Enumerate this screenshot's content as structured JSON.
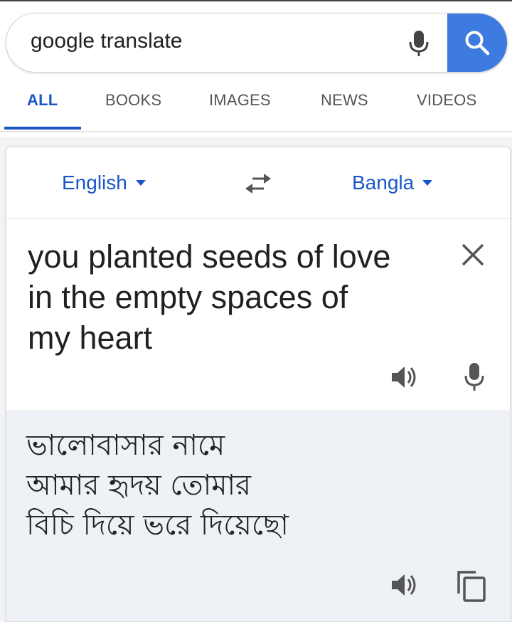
{
  "search": {
    "query": "google translate"
  },
  "tabs": [
    {
      "label": "ALL",
      "active": true
    },
    {
      "label": "BOOKS",
      "active": false
    },
    {
      "label": "IMAGES",
      "active": false
    },
    {
      "label": "NEWS",
      "active": false
    },
    {
      "label": "VIDEOS",
      "active": false
    }
  ],
  "translator": {
    "source_language": "English",
    "target_language": "Bangla",
    "source_text": "you planted seeds of love in the empty spaces of my heart",
    "translated_lines": [
      "ভালোবাসার নামে",
      "আমার হৃদয় তোমার",
      "বিচি দিয়ে ভরে দিয়েছো"
    ]
  },
  "icons": {
    "mic": "mic-icon",
    "search": "search-icon",
    "swap": "swap-languages-icon",
    "clear": "close-icon",
    "speaker": "speaker-icon",
    "copy": "copy-icon"
  },
  "colors": {
    "accent": "#1a56c8",
    "search_button": "#3d7be0",
    "target_bg": "#eef2f7"
  }
}
